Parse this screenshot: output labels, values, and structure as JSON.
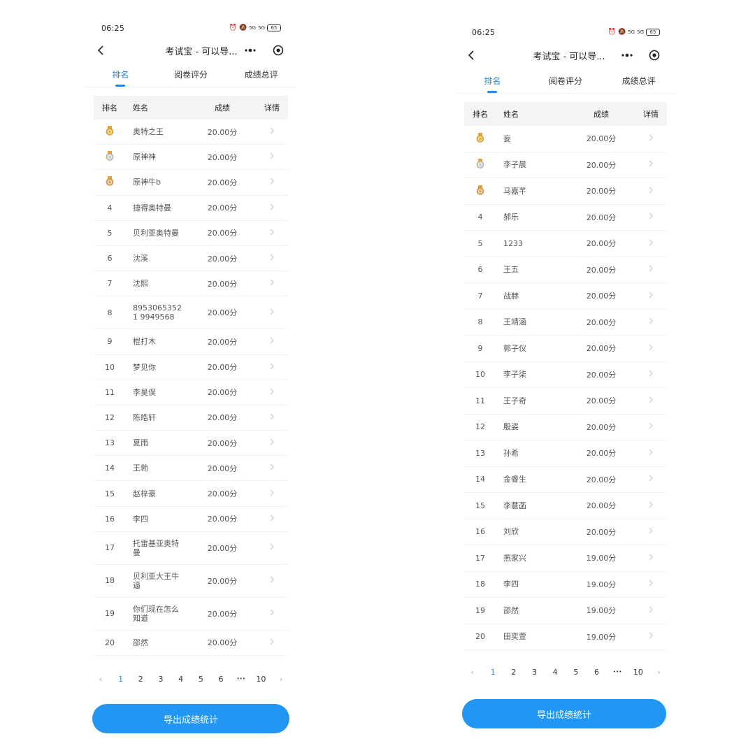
{
  "left": {
    "status": {
      "time": "06:25",
      "signal1": "5G",
      "signal2": "5G",
      "battery": "65"
    },
    "nav": {
      "title": "考试宝 - 可以导..."
    },
    "tabs": [
      {
        "label": "排名",
        "active": true
      },
      {
        "label": "阅卷评分",
        "active": false
      },
      {
        "label": "成绩总评",
        "active": false
      }
    ],
    "headers": {
      "rank": "排名",
      "name": "姓名",
      "score": "成绩",
      "detail": "详情"
    },
    "rows": [
      {
        "rank": "",
        "medal": "gold",
        "name": "奥特之王",
        "score": "20.00分"
      },
      {
        "rank": "",
        "medal": "silver",
        "name": "原神神",
        "score": "20.00分"
      },
      {
        "rank": "",
        "medal": "bronze",
        "name": "原神牛b",
        "score": "20.00分"
      },
      {
        "rank": "4",
        "name": "捷得奥特曼",
        "score": "20.00分"
      },
      {
        "rank": "5",
        "name": "贝利亚奥特曼",
        "score": "20.00分"
      },
      {
        "rank": "6",
        "name": "沈溪",
        "score": "20.00分"
      },
      {
        "rank": "7",
        "name": "沈熙",
        "score": "20.00分"
      },
      {
        "rank": "8",
        "name": "89530653521 9949568",
        "score": "20.00分"
      },
      {
        "rank": "9",
        "name": "棍打木",
        "score": "20.00分"
      },
      {
        "rank": "10",
        "name": "梦见你",
        "score": "20.00分"
      },
      {
        "rank": "11",
        "name": "李昊俣",
        "score": "20.00分"
      },
      {
        "rank": "12",
        "name": "陈皓轩",
        "score": "20.00分"
      },
      {
        "rank": "13",
        "name": "夏雨",
        "score": "20.00分"
      },
      {
        "rank": "14",
        "name": "王勃",
        "score": "20.00分"
      },
      {
        "rank": "15",
        "name": "赵梓豪",
        "score": "20.00分"
      },
      {
        "rank": "16",
        "name": "李四",
        "score": "20.00分"
      },
      {
        "rank": "17",
        "name": "托雷基亚奥特曼",
        "score": "20.00分"
      },
      {
        "rank": "18",
        "name": "贝利亚大王牛逼",
        "score": "20.00分"
      },
      {
        "rank": "19",
        "name": "你们现在怎么知道",
        "score": "20.00分"
      },
      {
        "rank": "20",
        "name": "邵然",
        "score": "20.00分"
      }
    ],
    "pager": {
      "prev": "‹",
      "pages": [
        "1",
        "2",
        "3",
        "4",
        "5",
        "6"
      ],
      "active": "1",
      "ellipsis": "•••",
      "last": "10",
      "next": "›"
    },
    "export_label": "导出成绩统计"
  },
  "right": {
    "status": {
      "time": "06:25",
      "signal1": "5G",
      "signal2": "5G",
      "battery": "65"
    },
    "nav": {
      "title": "考试宝 - 可以导..."
    },
    "tabs": [
      {
        "label": "排名",
        "active": true
      },
      {
        "label": "阅卷评分",
        "active": false
      },
      {
        "label": "成绩总评",
        "active": false
      }
    ],
    "headers": {
      "rank": "排名",
      "name": "姓名",
      "score": "成绩",
      "detail": "详情"
    },
    "rows": [
      {
        "rank": "",
        "medal": "gold",
        "name": "妄",
        "score": "20.00分"
      },
      {
        "rank": "",
        "medal": "silver",
        "name": "李子晨",
        "score": "20.00分"
      },
      {
        "rank": "",
        "medal": "bronze",
        "name": "马嘉芊",
        "score": "20.00分"
      },
      {
        "rank": "4",
        "name": "郝乐",
        "score": "20.00分"
      },
      {
        "rank": "5",
        "name": "1233",
        "score": "20.00分"
      },
      {
        "rank": "6",
        "name": "王五",
        "score": "20.00分"
      },
      {
        "rank": "7",
        "name": "战赫",
        "score": "20.00分"
      },
      {
        "rank": "8",
        "name": "王靖涵",
        "score": "20.00分"
      },
      {
        "rank": "9",
        "name": "郭子仪",
        "score": "20.00分"
      },
      {
        "rank": "10",
        "name": "李子柒",
        "score": "20.00分"
      },
      {
        "rank": "11",
        "name": "王子奇",
        "score": "20.00分"
      },
      {
        "rank": "12",
        "name": "殷姿",
        "score": "20.00分"
      },
      {
        "rank": "13",
        "name": "孙希",
        "score": "20.00分"
      },
      {
        "rank": "14",
        "name": "金睿生",
        "score": "20.00分"
      },
      {
        "rank": "15",
        "name": "李薏菡",
        "score": "20.00分"
      },
      {
        "rank": "16",
        "name": "刘欣",
        "score": "20.00分"
      },
      {
        "rank": "17",
        "name": "燕家兴",
        "score": "19.00分"
      },
      {
        "rank": "18",
        "name": "李四",
        "score": "19.00分"
      },
      {
        "rank": "19",
        "name": "邵然",
        "score": "19.00分"
      },
      {
        "rank": "20",
        "name": "田奕萱",
        "score": "19.00分"
      }
    ],
    "pager": {
      "prev": "‹",
      "pages": [
        "1",
        "2",
        "3",
        "4",
        "5",
        "6"
      ],
      "active": "1",
      "ellipsis": "•••",
      "last": "10",
      "next": "›"
    },
    "export_label": "导出成绩统计"
  },
  "colors": {
    "accent": "#1e88e5",
    "button": "#2196f3",
    "gold": "#e8b23a",
    "silver": "#c7ccd3",
    "bronze": "#d9a55e"
  },
  "icons": {
    "back": "chevron-left-icon",
    "more": "more-dots-icon",
    "close": "target-close-icon",
    "detail": "chevron-right-icon",
    "medal": "medal-icon"
  }
}
